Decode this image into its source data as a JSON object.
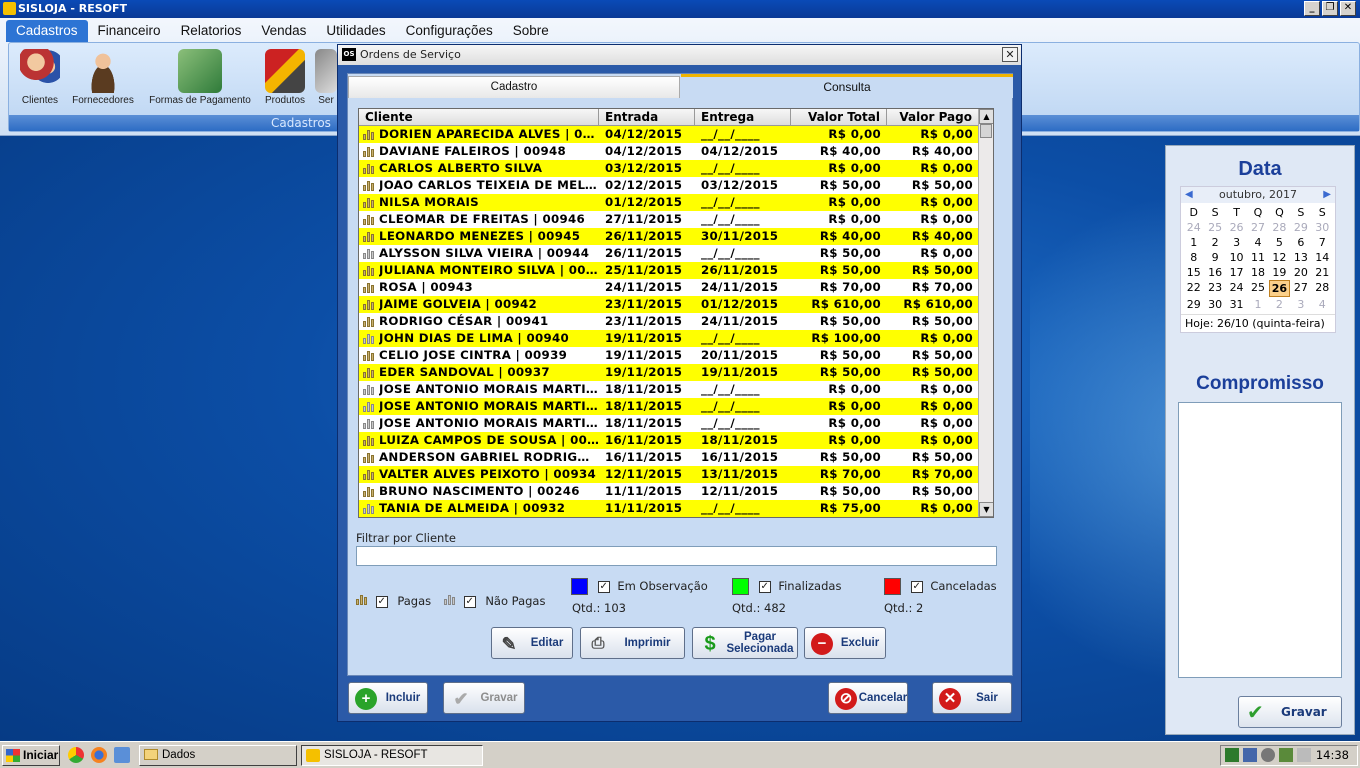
{
  "app": {
    "title": "SISLOJA - RESOFT",
    "window_buttons": [
      "_",
      "❐",
      "✕"
    ]
  },
  "menu": [
    "Cadastros",
    "Financeiro",
    "Relatorios",
    "Vendas",
    "Utilidades",
    "Configurações",
    "Sobre"
  ],
  "ribbon": {
    "group_label": "Cadastros",
    "buttons": [
      "Clientes",
      "Fornecedores",
      "Formas de Pagamento",
      "Produtos",
      "Ser"
    ]
  },
  "dialog": {
    "title": "Ordens de Serviço",
    "title_icon": "OS",
    "tabs": [
      "Cadastro",
      "Consulta"
    ],
    "columns": [
      "Cliente",
      "Entrada",
      "Entrega",
      "Valor Total",
      "Valor Pago"
    ],
    "rows": [
      {
        "cliente": "DORIEN APARECIDA ALVES | 00...",
        "entrada": "04/12/2015",
        "entrega": "__/__/____",
        "total": "R$ 0,00",
        "pago": "R$ 0,00",
        "hl": true,
        "paga": true
      },
      {
        "cliente": "DAVIANE FALEIROS | 00948",
        "entrada": "04/12/2015",
        "entrega": "04/12/2015",
        "total": "R$ 40,00",
        "pago": "R$ 40,00",
        "hl": false,
        "paga": true
      },
      {
        "cliente": "CARLOS ALBERTO SILVA",
        "entrada": "03/12/2015",
        "entrega": "__/__/____",
        "total": "R$ 0,00",
        "pago": "R$ 0,00",
        "hl": true,
        "paga": true
      },
      {
        "cliente": "JOAO CARLOS TEIXEIA DE MELO ...",
        "entrada": "02/12/2015",
        "entrega": "03/12/2015",
        "total": "R$ 50,00",
        "pago": "R$ 50,00",
        "hl": false,
        "paga": true
      },
      {
        "cliente": "NILSA MORAIS",
        "entrada": "01/12/2015",
        "entrega": "__/__/____",
        "total": "R$ 0,00",
        "pago": "R$ 0,00",
        "hl": true,
        "paga": true
      },
      {
        "cliente": "CLEOMAR DE FREITAS | 00946",
        "entrada": "27/11/2015",
        "entrega": "__/__/____",
        "total": "R$ 0,00",
        "pago": "R$ 0,00",
        "hl": false,
        "paga": true
      },
      {
        "cliente": "LEONARDO MENEZES | 00945",
        "entrada": "26/11/2015",
        "entrega": "30/11/2015",
        "total": "R$ 40,00",
        "pago": "R$ 40,00",
        "hl": true,
        "paga": true
      },
      {
        "cliente": "ALYSSON SILVA VIEIRA | 00944",
        "entrada": "26/11/2015",
        "entrega": "__/__/____",
        "total": "R$ 50,00",
        "pago": "R$ 0,00",
        "hl": false,
        "paga": false
      },
      {
        "cliente": "JULIANA MONTEIRO SILVA | 007...",
        "entrada": "25/11/2015",
        "entrega": "26/11/2015",
        "total": "R$ 50,00",
        "pago": "R$ 50,00",
        "hl": true,
        "paga": true
      },
      {
        "cliente": "ROSA | 00943",
        "entrada": "24/11/2015",
        "entrega": "24/11/2015",
        "total": "R$ 70,00",
        "pago": "R$ 70,00",
        "hl": false,
        "paga": true
      },
      {
        "cliente": "JAIME GOLVEIA | 00942",
        "entrada": "23/11/2015",
        "entrega": "01/12/2015",
        "total": "R$ 610,00",
        "pago": "R$ 610,00",
        "hl": true,
        "paga": true
      },
      {
        "cliente": "RODRIGO CÉSAR | 00941",
        "entrada": "23/11/2015",
        "entrega": "24/11/2015",
        "total": "R$ 50,00",
        "pago": "R$ 50,00",
        "hl": false,
        "paga": true
      },
      {
        "cliente": "JOHN DIAS DE LIMA | 00940",
        "entrada": "19/11/2015",
        "entrega": "__/__/____",
        "total": "R$ 100,00",
        "pago": "R$ 0,00",
        "hl": true,
        "paga": false
      },
      {
        "cliente": "CELIO JOSE CINTRA | 00939",
        "entrada": "19/11/2015",
        "entrega": "20/11/2015",
        "total": "R$ 50,00",
        "pago": "R$ 50,00",
        "hl": false,
        "paga": true
      },
      {
        "cliente": "EDER SANDOVAL | 00937",
        "entrada": "19/11/2015",
        "entrega": "19/11/2015",
        "total": "R$ 50,00",
        "pago": "R$ 50,00",
        "hl": true,
        "paga": true
      },
      {
        "cliente": "JOSE ANTONIO MORAIS MARTIN...",
        "entrada": "18/11/2015",
        "entrega": "__/__/____",
        "total": "R$ 0,00",
        "pago": "R$ 0,00",
        "hl": false,
        "paga": false
      },
      {
        "cliente": "JOSE ANTONIO MORAIS MARTIN...",
        "entrada": "18/11/2015",
        "entrega": "__/__/____",
        "total": "R$ 0,00",
        "pago": "R$ 0,00",
        "hl": true,
        "paga": false
      },
      {
        "cliente": "JOSE ANTONIO MORAIS MARTIN...",
        "entrada": "18/11/2015",
        "entrega": "__/__/____",
        "total": "R$ 0,00",
        "pago": "R$ 0,00",
        "hl": false,
        "paga": false
      },
      {
        "cliente": "LUIZA CAMPOS DE SOUSA | 00936",
        "entrada": "16/11/2015",
        "entrega": "18/11/2015",
        "total": "R$ 0,00",
        "pago": "R$ 0,00",
        "hl": true,
        "paga": true
      },
      {
        "cliente": "ANDERSON GABRIEL RODRIGUES...",
        "entrada": "16/11/2015",
        "entrega": "16/11/2015",
        "total": "R$ 50,00",
        "pago": "R$ 50,00",
        "hl": false,
        "paga": true
      },
      {
        "cliente": "VALTER ALVES PEIXOTO | 00934",
        "entrada": "12/11/2015",
        "entrega": "13/11/2015",
        "total": "R$ 70,00",
        "pago": "R$ 70,00",
        "hl": true,
        "paga": true
      },
      {
        "cliente": "BRUNO NASCIMENTO | 00246",
        "entrada": "11/11/2015",
        "entrega": "12/11/2015",
        "total": "R$ 50,00",
        "pago": "R$ 50,00",
        "hl": false,
        "paga": true
      },
      {
        "cliente": "TANIA DE ALMEIDA | 00932",
        "entrada": "11/11/2015",
        "entrega": "__/__/____",
        "total": "R$ 75,00",
        "pago": "R$ 0,00",
        "hl": true,
        "paga": false
      }
    ],
    "filter": {
      "label": "Filtrar por Cliente",
      "value": ""
    },
    "legend": {
      "pagas": "Pagas",
      "nao_pagas": "Não Pagas",
      "em_observacao": "Em Observação",
      "finalizadas": "Finalizadas",
      "canceladas": "Canceladas",
      "qtd_obs": "Qtd.: 103",
      "qtd_fin": "Qtd.: 482",
      "qtd_can": "Qtd.: 2",
      "color_obs": "#0000ff",
      "color_fin": "#00ff00",
      "color_can": "#ff0000",
      "row_highlight": "#ffff00"
    },
    "actions": {
      "editar": "Editar",
      "imprimir": "Imprimir",
      "pagar_1": "Pagar",
      "pagar_2": "Selecionada",
      "excluir": "Excluir"
    },
    "footer": {
      "incluir": "Incluir",
      "gravar": "Gravar",
      "cancelar": "Cancelar",
      "sair": "Sair"
    }
  },
  "side": {
    "data_title": "Data",
    "calendar": {
      "month": "outubro, 2017",
      "weekdays": [
        "D",
        "S",
        "T",
        "Q",
        "Q",
        "S",
        "S"
      ],
      "days": [
        {
          "d": "24",
          "dim": true
        },
        {
          "d": "25",
          "dim": true
        },
        {
          "d": "26",
          "dim": true
        },
        {
          "d": "27",
          "dim": true
        },
        {
          "d": "28",
          "dim": true
        },
        {
          "d": "29",
          "dim": true
        },
        {
          "d": "30",
          "dim": true
        },
        {
          "d": "1"
        },
        {
          "d": "2"
        },
        {
          "d": "3"
        },
        {
          "d": "4"
        },
        {
          "d": "5"
        },
        {
          "d": "6"
        },
        {
          "d": "7"
        },
        {
          "d": "8"
        },
        {
          "d": "9"
        },
        {
          "d": "10"
        },
        {
          "d": "11"
        },
        {
          "d": "12"
        },
        {
          "d": "13"
        },
        {
          "d": "14"
        },
        {
          "d": "15"
        },
        {
          "d": "16"
        },
        {
          "d": "17"
        },
        {
          "d": "18"
        },
        {
          "d": "19"
        },
        {
          "d": "20"
        },
        {
          "d": "21"
        },
        {
          "d": "22"
        },
        {
          "d": "23"
        },
        {
          "d": "24"
        },
        {
          "d": "25"
        },
        {
          "d": "26",
          "today": true
        },
        {
          "d": "27"
        },
        {
          "d": "28"
        },
        {
          "d": "29"
        },
        {
          "d": "30"
        },
        {
          "d": "31"
        },
        {
          "d": "1",
          "dim": true
        },
        {
          "d": "2",
          "dim": true
        },
        {
          "d": "3",
          "dim": true
        },
        {
          "d": "4",
          "dim": true
        }
      ],
      "today_label": "Hoje: 26/10 (quinta-feira)"
    },
    "compromisso_title": "Compromisso",
    "gravar": "Gravar"
  },
  "taskbar": {
    "start": "Iniciar",
    "tasks": [
      "Dados",
      "SISLOJA - RESOFT"
    ],
    "clock": "14:38"
  }
}
